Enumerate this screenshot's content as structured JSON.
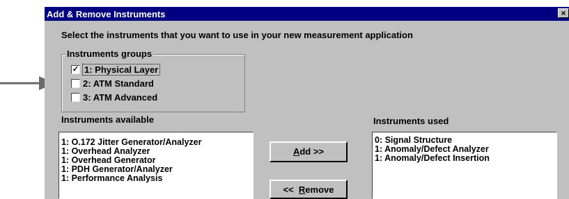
{
  "window": {
    "title": "Add & Remove Instruments",
    "close_label": "×"
  },
  "instruction": "Select the instruments that you want to use in your new measurement application",
  "groups": {
    "label": "Instruments groups",
    "items": [
      {
        "label": "1:  Physical Layer",
        "checked": true,
        "check_mark": "✓"
      },
      {
        "label": "2:  ATM Standard",
        "checked": false,
        "check_mark": ""
      },
      {
        "label": "3:  ATM Advanced",
        "checked": false,
        "check_mark": ""
      }
    ]
  },
  "available": {
    "label": "Instruments available",
    "items": [
      "1: O.172 Jitter Generator/Analyzer",
      "1: Overhead Analyzer",
      "1: Overhead Generator",
      "1: PDH Generator/Analyzer",
      "1: Performance Analysis"
    ]
  },
  "used": {
    "label": "Instruments used",
    "items": [
      "0: Signal Structure",
      "1: Anomaly/Defect Analyzer",
      "1: Anomaly/Defect Insertion"
    ]
  },
  "buttons": {
    "add_mnemonic": "A",
    "add_rest": "dd  >>",
    "remove_prefix": "<<  ",
    "remove_mnemonic": "R",
    "remove_rest": "emove"
  },
  "colors": {
    "titlebar": "#000080",
    "dialog_bg": "#c0c0c0",
    "arrow": "#6a6a6a"
  },
  "icons": {
    "close": "close-icon",
    "pointer": "pointer-arrow-icon"
  }
}
